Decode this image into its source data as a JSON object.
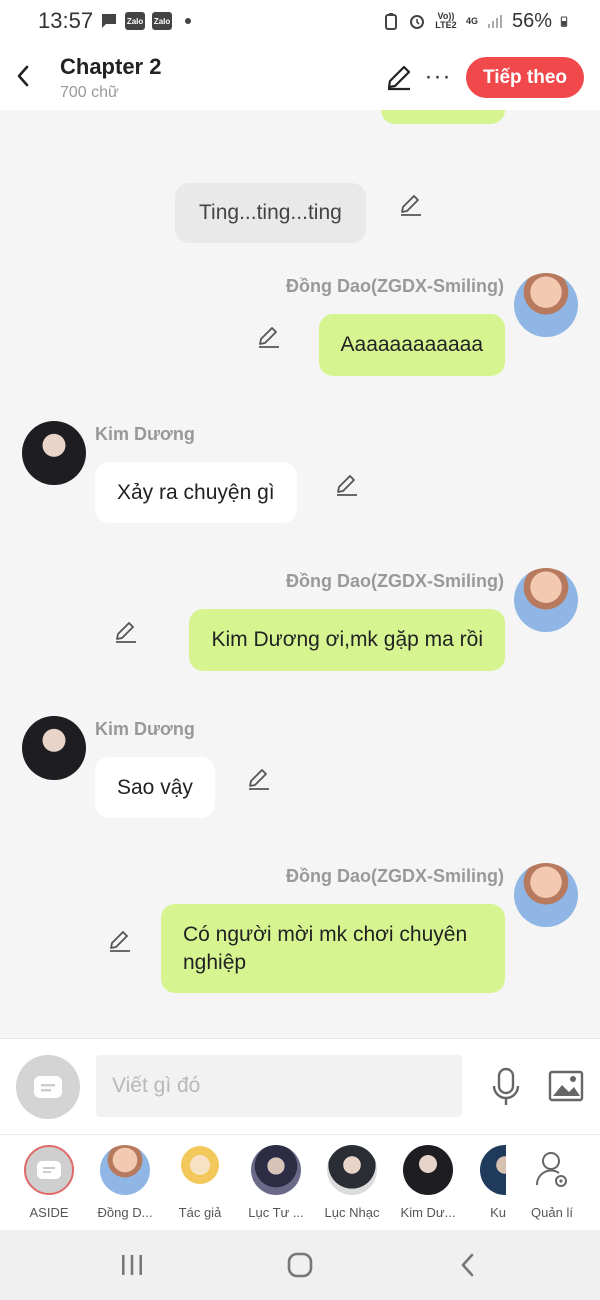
{
  "status_bar": {
    "time": "13:57",
    "app_icons": [
      "message-icon",
      "zalo-icon",
      "zalo-icon"
    ],
    "app_label": "Zalo",
    "network": "Vo)) LTE2",
    "network_type": "4G",
    "battery": "56%"
  },
  "header": {
    "title": "Chapter 2",
    "subtitle": "700 chữ",
    "next_label": "Tiếp theo",
    "more_label": "···"
  },
  "messages": [
    {
      "sender": "",
      "text": "",
      "kind": "mine-partial"
    },
    {
      "sender": "",
      "text": "Ting...ting...ting",
      "kind": "aside"
    },
    {
      "sender": "Đồng Dao(ZGDX-Smiling)",
      "text": "Aaaaaaaaaaaa",
      "kind": "mine"
    },
    {
      "sender": "Kim Dương",
      "text": "Xảy ra chuyện gì",
      "kind": "other"
    },
    {
      "sender": "Đồng Dao(ZGDX-Smiling)",
      "text": "Kim Dương ơi,mk gặp ma rồi",
      "kind": "mine"
    },
    {
      "sender": "Kim Dương",
      "text": "Sao vậy",
      "kind": "other"
    },
    {
      "sender": "Đồng Dao(ZGDX-Smiling)",
      "text": "Có người mời mk chơi chuyên nghiệp",
      "kind": "mine"
    }
  ],
  "composer": {
    "placeholder": "Viết gì đó"
  },
  "characters": [
    {
      "label": "ASIDE",
      "avatar": "aside-icon"
    },
    {
      "label": "Đồng D...",
      "avatar": "dong-dao-avatar"
    },
    {
      "label": "Tác giả",
      "avatar": "author-avatar"
    },
    {
      "label": "Lục Tư ...",
      "avatar": "luc-tu-avatar"
    },
    {
      "label": "Lục Nhạc",
      "avatar": "luc-nhac-avatar"
    },
    {
      "label": "Kim Dư...",
      "avatar": "kim-duong-avatar"
    },
    {
      "label": "Ku",
      "avatar": "ku-avatar"
    },
    {
      "label": "Quản lí",
      "avatar": "manage-icon"
    }
  ],
  "colors": {
    "accent": "#f0484b",
    "my_bubble": "#d6f591",
    "other_bubble": "#ffffff",
    "aside_bubble": "#e9e9e9"
  }
}
